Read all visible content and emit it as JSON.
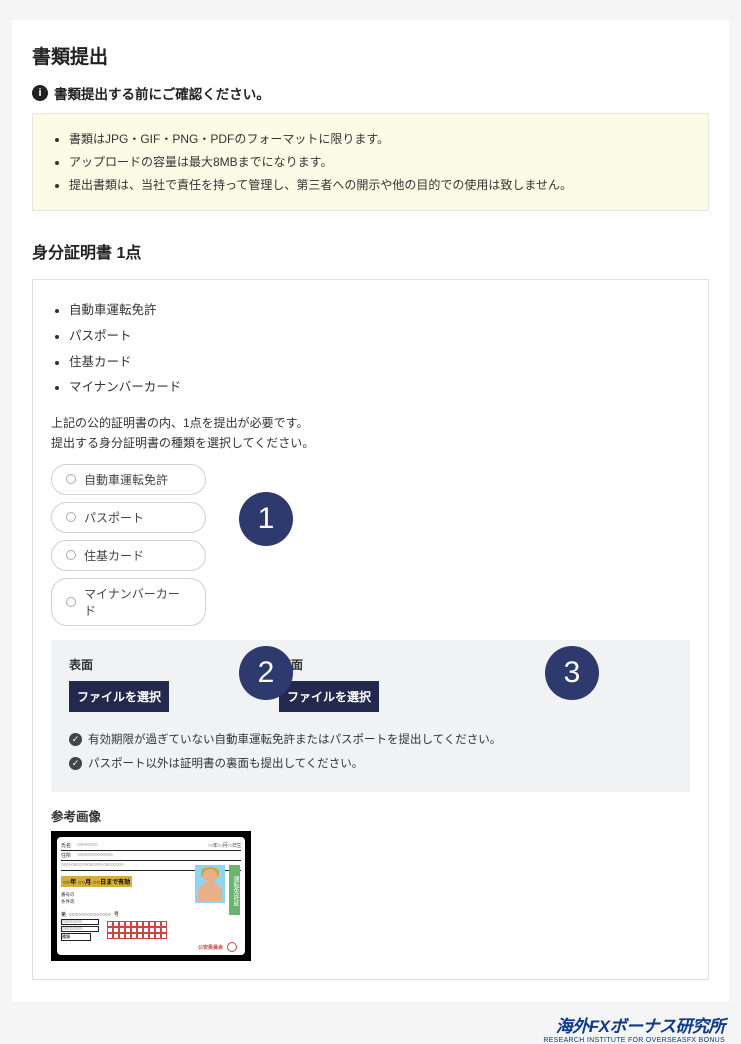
{
  "page_title": "書類提出",
  "confirm_text": "書類提出する前にご確認ください。",
  "notices": [
    "書類はJPG・GIF・PNG・PDFのフォーマットに限ります。",
    "アップロードの容量は最大8MBまでになります。",
    "提出書類は、当社で責任を持って管理し、第三者への開示や他の目的での使用は致しません。"
  ],
  "id_section_title": "身分証明書 1点",
  "id_types": [
    "自動車運転免許",
    "パスポート",
    "住基カード",
    "マイナンバーカード"
  ],
  "id_note_line1": "上記の公的証明書の内、1点を提出が必要です。",
  "id_note_line2": "提出する身分証明書の種類を選択してください。",
  "radio_options": [
    "自動車運転免許",
    "パスポート",
    "住基カード",
    "マイナンバーカード"
  ],
  "badge1": "1",
  "badge2": "2",
  "badge3": "3",
  "upload_front_label": "表面",
  "upload_back_label": "裏面",
  "file_button_label": "ファイルを選択",
  "check_note1": "有効期限が過ぎていない自動車運転免許またはパスポートを提出してください。",
  "check_note2": "パスポート以外は証明書の裏面も提出してください。",
  "ref_title": "参考画像",
  "license": {
    "gold_text": "○○年 ○○月 ○○日まで有効",
    "side_text": "運転免許証",
    "stamp_text": "公安委員会",
    "row_label_name": "氏名",
    "row_label_addr": "住所"
  },
  "brand_main": "海外FXボーナス研究所",
  "brand_sub": "RESEARCH INSTITUTE FOR OVERSEASFX BONUS"
}
